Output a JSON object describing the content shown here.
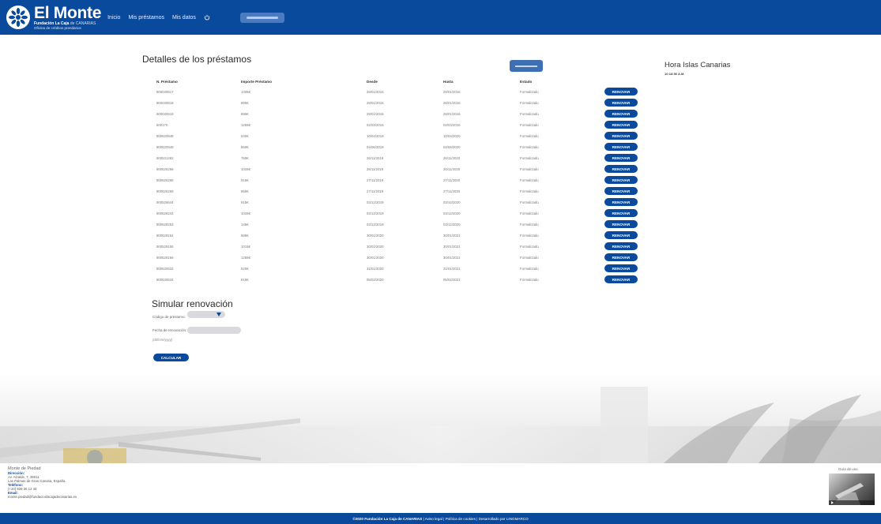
{
  "header": {
    "brand": "El Monte",
    "brand_sub_bold": "Fundación La Caja",
    "brand_sub_rest": "de CANARIAS",
    "brand_tagline": "Oficina de créditos prendarios",
    "nav": [
      "Inicio",
      "Mis préstamos",
      "Mis datos"
    ]
  },
  "loans": {
    "title": "Detalles de los préstamos",
    "columns": [
      "N. Préstamo",
      "Importe Préstamo",
      "Desde",
      "Hasta",
      "Estado"
    ],
    "renew_label": "RENOVAR",
    "rows": [
      [
        "900030617",
        "1305€",
        "28/01/2015",
        "28/01/2016",
        "Formalizado"
      ],
      [
        "900030618",
        "895€",
        "28/01/2015",
        "28/01/2016",
        "Formalizado"
      ],
      [
        "900030619",
        "895€",
        "28/01/2015",
        "28/01/2016",
        "Formalizado"
      ],
      [
        "500170",
        "1255€",
        "02/03/2015",
        "02/03/2016",
        "Formalizado"
      ],
      [
        "900520948",
        "540€",
        "10/04/2019",
        "10/04/2020",
        "Formalizado"
      ],
      [
        "900520949",
        "560€",
        "04/06/2019",
        "04/06/2020",
        "Formalizado"
      ],
      [
        "900521282",
        "760€",
        "26/11/2019",
        "26/11/2020",
        "Formalizado"
      ],
      [
        "900526266",
        "1025€",
        "26/11/2019",
        "26/11/2020",
        "Formalizado"
      ],
      [
        "900526268",
        "915€",
        "27/11/2019",
        "27/11/2020",
        "Formalizado"
      ],
      [
        "900526269",
        "855€",
        "27/11/2019",
        "27/11/2020",
        "Formalizado"
      ],
      [
        "900526644",
        "915€",
        "03/12/2019",
        "03/12/2020",
        "Formalizado"
      ],
      [
        "900528244",
        "1025€",
        "03/12/2019",
        "03/12/2020",
        "Formalizado"
      ],
      [
        "900528253",
        "145€",
        "03/12/2019",
        "03/12/2020",
        "Formalizado"
      ],
      [
        "900529154",
        "685€",
        "30/01/2020",
        "30/01/2021",
        "Formalizado"
      ],
      [
        "900529155",
        "1015€",
        "30/01/2020",
        "30/01/2021",
        "Formalizado"
      ],
      [
        "900529156",
        "1265€",
        "30/01/2020",
        "30/01/2021",
        "Formalizado"
      ],
      [
        "900530632",
        "520€",
        "31/01/2020",
        "31/01/2021",
        "Formalizado"
      ],
      [
        "900530634",
        "615€",
        "05/02/2020",
        "05/02/2021",
        "Formalizado"
      ]
    ]
  },
  "clock": {
    "title": "Hora Islas Canarias",
    "time": "10:18:56 A.M."
  },
  "simulate": {
    "title": "Simular renovación",
    "code_label": "Código de préstamo:",
    "date_label": "Fecha de renovación:",
    "date_hint": "(dd/mm/yyyy)",
    "calc_label": "CALCULAR"
  },
  "footer": {
    "org": "Monte de Piedad",
    "address_label": "Dirección:",
    "address_1": "Av. Alcalde, 7, 35011",
    "address_2": "Las Palmas de Gran Canaria, España",
    "phone_label": "Teléfono:",
    "phone": "(+34) 928 36 12 40",
    "email_label": "Email:",
    "email": "monte.piedad@fundacionlacajadecanarias.es",
    "guide_label": "Guía de uso",
    "bar_bold": "©2020 Fundación La Caja de CANARIAS",
    "bar_links": "| Aviso legal | Política de cookies | Desarrollado por LINGMARCO"
  },
  "colors": {
    "primary": "#0a4a9c",
    "accent": "#3f6fb3"
  }
}
